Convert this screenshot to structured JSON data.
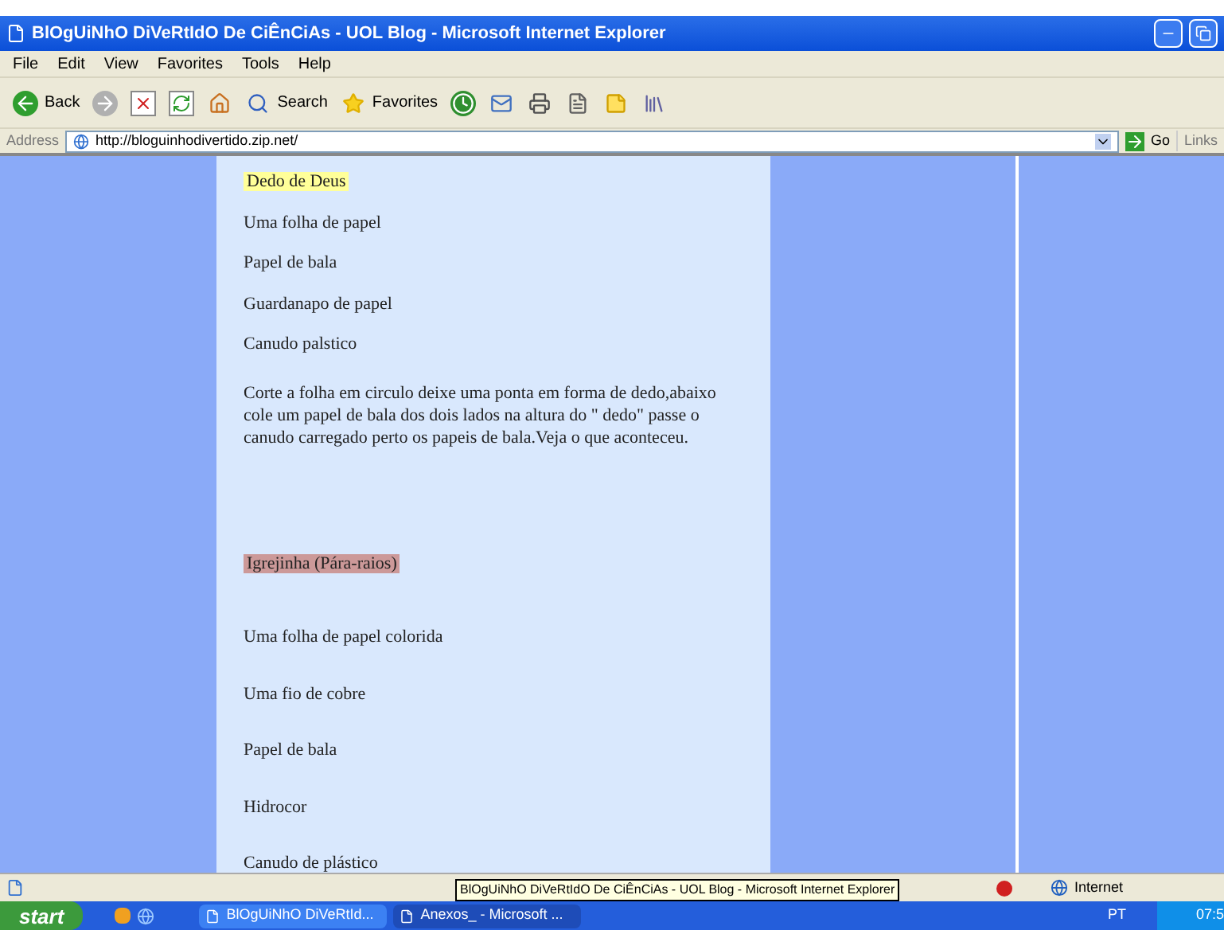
{
  "window": {
    "title": "BlOgUiNhO DiVeRtIdO De CiÊnCiAs - UOL Blog - Microsoft Internet Explorer"
  },
  "menu": [
    "File",
    "Edit",
    "View",
    "Favorites",
    "Tools",
    "Help"
  ],
  "toolbar": [
    {
      "kind": "back",
      "label": "Back"
    },
    {
      "kind": "forward"
    },
    {
      "kind": "stop"
    },
    {
      "kind": "refresh"
    },
    {
      "kind": "home"
    },
    {
      "kind": "search",
      "label": "Search"
    },
    {
      "kind": "favorites",
      "label": "Favorites"
    },
    {
      "kind": "history"
    },
    {
      "kind": "mail"
    },
    {
      "kind": "print"
    },
    {
      "kind": "edit"
    },
    {
      "kind": "note"
    },
    {
      "kind": "research"
    }
  ],
  "address": {
    "label": "Address",
    "value": "http://bloguinhodivertido.zip.net/",
    "go": "Go",
    "links": "Links"
  },
  "sections": [
    {
      "title": "Dedo de Deus",
      "color": "#ffff99",
      "items": [
        "Uma folha de papel",
        "Papel de bala",
        "Guardanapo de papel",
        "Canudo palstico"
      ],
      "note": "Corte a folha em circulo deixe uma ponta em forma de dedo,abaixo cole um papel de bala dos dois lados na altura do \" dedo\" passe o canudo carregado perto os papeis de bala.Veja o que aconteceu."
    },
    {
      "title": "Igrejinha  (Pára-raios)",
      "color": "#cc9999",
      "items": [
        "Uma folha de papel colorida",
        "Uma fio de cobre",
        "Papel de bala",
        "Hidrocor",
        "Canudo de plástico"
      ]
    }
  ],
  "status_bar": {
    "tooltip": "BlOgUiNhO DiVeRtIdO De CiÊnCiAs - UOL Blog - Microsoft Internet Explorer",
    "zone": "Internet"
  },
  "taskbar": {
    "start": "start",
    "tasks": [
      {
        "label": "BlOgUiNhO DiVeRtId...",
        "selected": false
      },
      {
        "label": "Anexos_ - Microsoft ...",
        "selected": true
      }
    ],
    "language": "PT",
    "clock": "07:5"
  }
}
